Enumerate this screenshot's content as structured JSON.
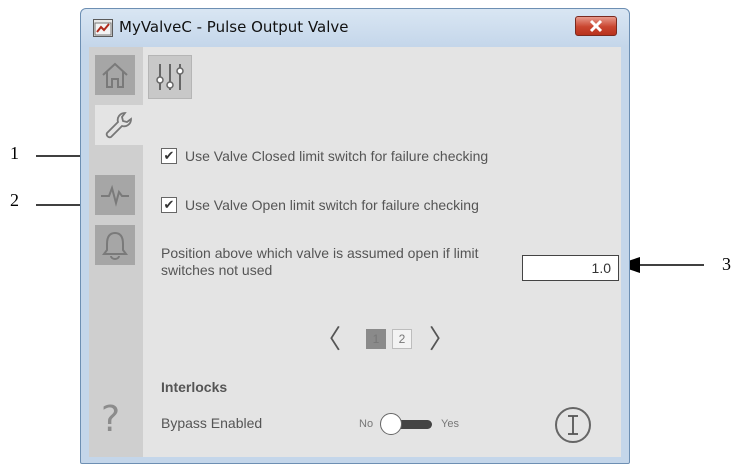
{
  "callouts": [
    "1",
    "2",
    "3"
  ],
  "window": {
    "title": "MyValveC - Pulse Output Valve",
    "close_label": "close"
  },
  "sidebar": {
    "tabs": [
      {
        "icon": "home-icon"
      },
      {
        "icon": "wrench-icon"
      },
      {
        "icon": "trend-icon"
      },
      {
        "icon": "bell-icon"
      }
    ],
    "help_label": "?"
  },
  "settings": {
    "closed_limit_label": "Use Valve Closed limit switch for failure checking",
    "closed_limit_checked": true,
    "open_limit_label": "Use Valve Open limit switch for failure checking",
    "open_limit_checked": true,
    "position_label": "Position above which valve is assumed open if limit switches not used",
    "position_value": "1.0"
  },
  "pager": {
    "prev": "〈",
    "next": "〉",
    "pages": [
      "1",
      "2"
    ]
  },
  "interlocks": {
    "heading": "Interlocks",
    "bypass_label": "Bypass Enabled",
    "toggle_off": "No",
    "toggle_on": "Yes",
    "bypass_state": "No"
  },
  "colors": {
    "title_gradient": "#c4d6ea",
    "close_red": "#c9452f",
    "panel_bg": "#e4e4e4",
    "sidebar_bg": "#cfcfcf"
  }
}
